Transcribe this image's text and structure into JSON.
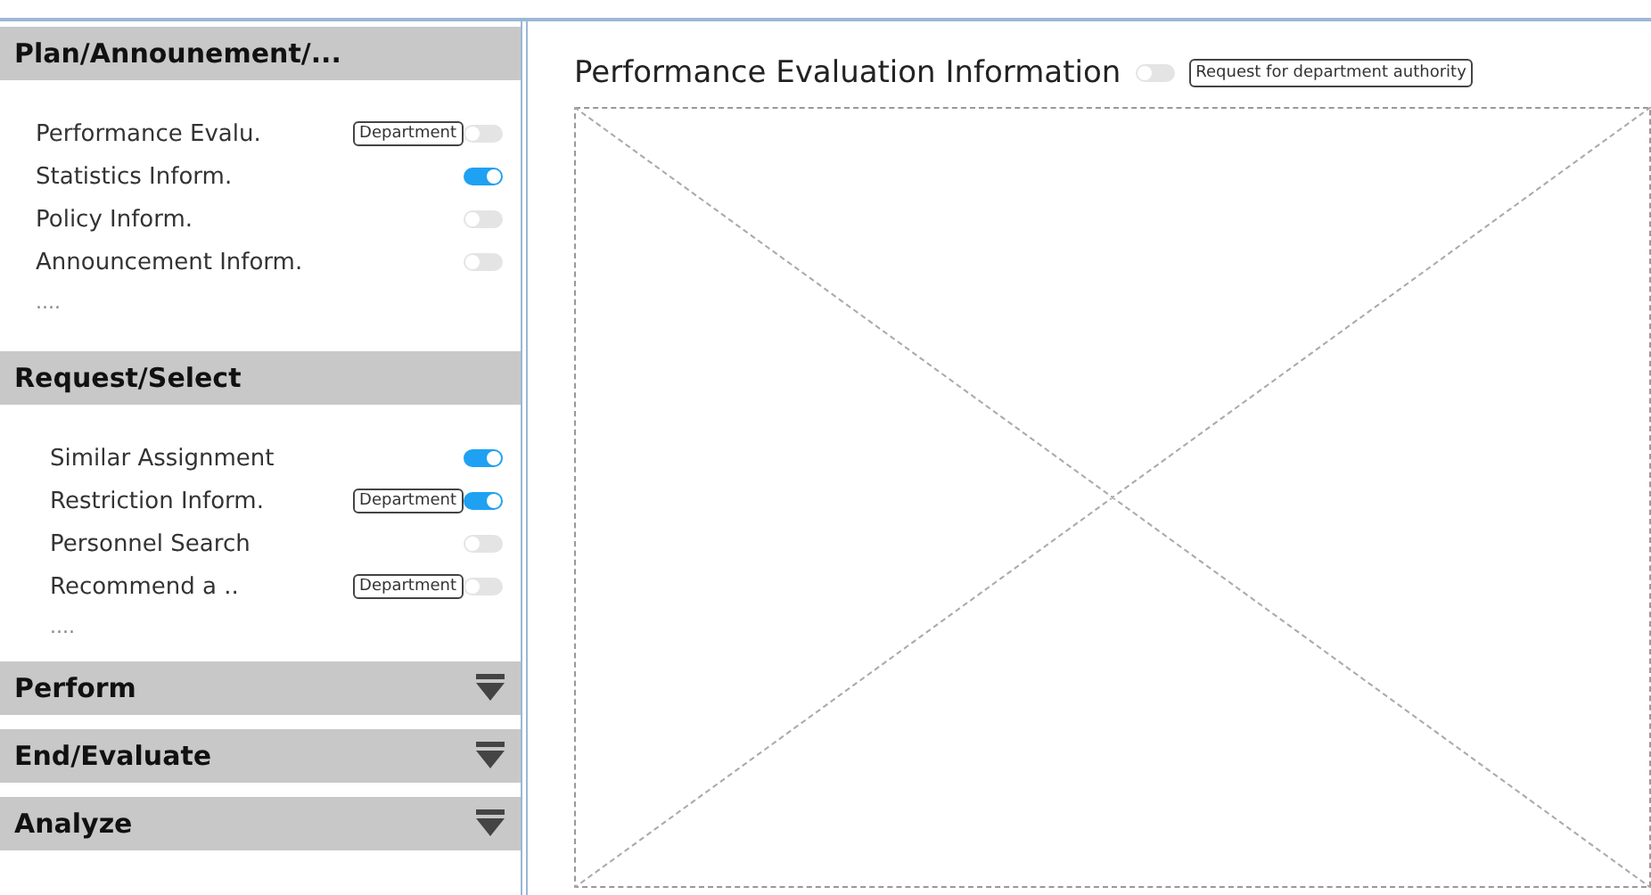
{
  "sidebar": {
    "sections": [
      {
        "title": "Plan/Announement/...",
        "expanded": true,
        "items": [
          {
            "label": "Performance Evalu.",
            "badge": "Department",
            "on": false
          },
          {
            "label": "Statistics Inform.",
            "on": true
          },
          {
            "label": "Policy Inform.",
            "on": false
          },
          {
            "label": "Announcement Inform.",
            "on": false
          }
        ],
        "more": "...."
      },
      {
        "title": "Request/Select",
        "expanded": true,
        "items": [
          {
            "label": "Similar Assignment",
            "on": true
          },
          {
            "label": "Restriction Inform.",
            "badge": "Department",
            "on": true
          },
          {
            "label": "Personnel Search",
            "on": false
          },
          {
            "label": "Recommend a ..",
            "badge": "Department",
            "on": false
          }
        ],
        "more": "...."
      },
      {
        "title": "Perform",
        "expanded": false
      },
      {
        "title": "End/Evaluate",
        "expanded": false
      },
      {
        "title": "Analyze",
        "expanded": false
      }
    ]
  },
  "main": {
    "title": "Performance Evaluation Information",
    "toggle": {
      "on": false
    },
    "badge": "Request for department authority"
  }
}
